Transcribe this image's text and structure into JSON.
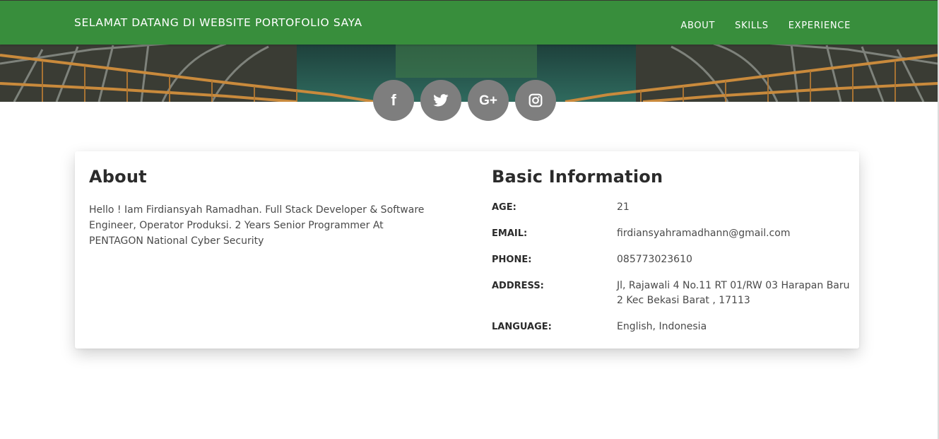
{
  "navbar": {
    "brand": "SELAMAT DATANG DI WEBSITE PORTOFOLIO SAYA",
    "links": [
      "ABOUT",
      "SKILLS",
      "EXPERIENCE"
    ],
    "color": "#388e3c"
  },
  "social": [
    {
      "icon": "facebook-icon",
      "glyph": "f"
    },
    {
      "icon": "twitter-icon"
    },
    {
      "icon": "google-plus-icon",
      "glyph": "G+"
    },
    {
      "icon": "instagram-icon"
    }
  ],
  "about": {
    "title": "About",
    "text": "Hello ! Iam Firdiansyah Ramadhan. Full Stack Developer & Software Engineer, Operator Produksi. 2 Years Senior Programmer At PENTAGON National Cyber Security"
  },
  "basic_info": {
    "title": "Basic Information",
    "rows": [
      {
        "label": "AGE:",
        "value": "21"
      },
      {
        "label": "EMAIL:",
        "value": "firdiansyahramadhann@gmail.com"
      },
      {
        "label": "PHONE:",
        "value": "085773023610"
      },
      {
        "label": "ADDRESS:",
        "value": "Jl, Rajawali 4 No.11 RT 01/RW 03 Harapan Baru 2 Kec Bekasi Barat , 17113"
      },
      {
        "label": "LANGUAGE:",
        "value": "English, Indonesia"
      }
    ]
  }
}
